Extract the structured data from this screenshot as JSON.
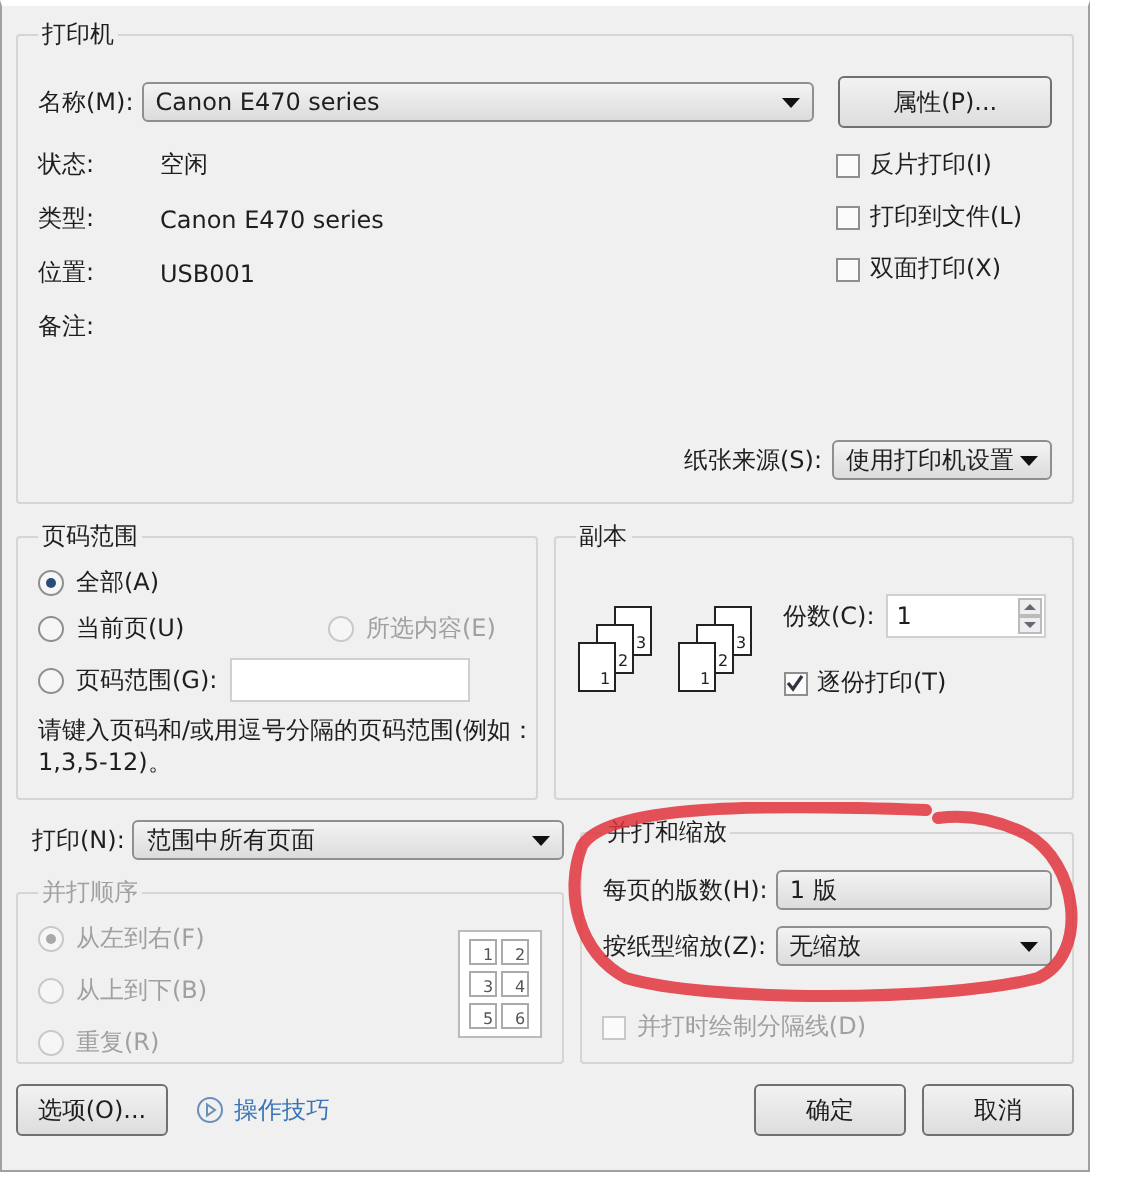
{
  "printer": {
    "title": "打印机",
    "name_label": "名称(M):",
    "name_value": "Canon E470 series",
    "properties_button": "属性(P)...",
    "info": [
      {
        "label": "状态:",
        "value": "空闲"
      },
      {
        "label": "类型:",
        "value": "Canon E470 series"
      },
      {
        "label": "位置:",
        "value": "USB001"
      },
      {
        "label": "备注:"
      }
    ],
    "options": [
      {
        "label": "反片打印(I)",
        "checked": false
      },
      {
        "label": "打印到文件(L)",
        "checked": false
      },
      {
        "label": "双面打印(X)",
        "checked": false
      }
    ],
    "paper_source_label": "纸张来源(S):",
    "paper_source_value": "使用打印机设置"
  },
  "page_range": {
    "title": "页码范围",
    "choices": [
      {
        "label": "全部(A)",
        "selected": true,
        "disabled": false
      },
      {
        "label": "当前页(U)",
        "selected": false,
        "disabled": false
      },
      {
        "label": "所选内容(E)",
        "selected": false,
        "disabled": true
      },
      {
        "label": "页码范围(G):",
        "selected": false,
        "disabled": false
      }
    ],
    "hint": "请键入页码和/或用逗号分隔的页码范围(例如：1,3,5-12)。"
  },
  "copies": {
    "title": "副本",
    "stacks": [
      {
        "pages": [
          "1",
          "2",
          "3"
        ]
      },
      {
        "pages": [
          "1",
          "2",
          "3"
        ]
      }
    ],
    "count_label": "份数(C):",
    "count_value": "1",
    "collate": {
      "label": "逐份打印(T)",
      "checked": true
    }
  },
  "print_what": {
    "label": "打印(N):",
    "value": "范围中所有页面"
  },
  "collate_order": {
    "title": "并打顺序",
    "disabled": true,
    "choices": [
      {
        "label": "从左到右(F)",
        "selected": true
      },
      {
        "label": "从上到下(B)",
        "selected": false
      },
      {
        "label": "重复(R)",
        "selected": false
      }
    ],
    "preview_pages": [
      "1",
      "2",
      "3",
      "4",
      "5",
      "6"
    ]
  },
  "zoom": {
    "title": "并打和缩放",
    "pages_per_sheet_label": "每页的版数(H):",
    "pages_per_sheet_value": "1 版",
    "scale_label": "按纸型缩放(Z):",
    "scale_value": "无缩放",
    "separator": {
      "label": "并打时绘制分隔线(D)",
      "checked": false,
      "disabled": true
    }
  },
  "footer": {
    "options_button": "选项(O)...",
    "tips_link": "操作技巧",
    "ok_button": "确定",
    "cancel_button": "取消"
  }
}
